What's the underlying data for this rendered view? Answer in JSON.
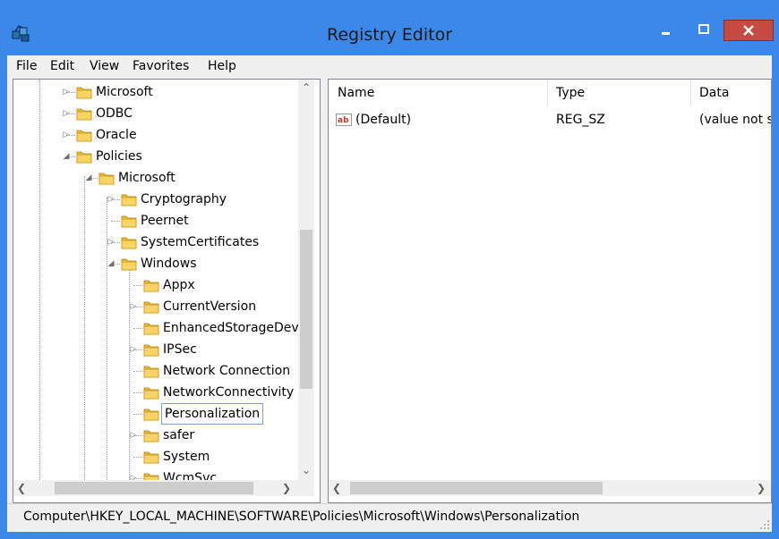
{
  "window": {
    "title": "Registry Editor",
    "accent_color": "#3c88e8",
    "close_color": "#c74a41"
  },
  "menu": [
    {
      "label": "File"
    },
    {
      "label": "Edit"
    },
    {
      "label": "View"
    },
    {
      "label": "Favorites"
    },
    {
      "label": "Help"
    }
  ],
  "tree": {
    "items": [
      {
        "label": "Microsoft",
        "depth": 1,
        "expander": "collapsed"
      },
      {
        "label": "ODBC",
        "depth": 1,
        "expander": "collapsed"
      },
      {
        "label": "Oracle",
        "depth": 1,
        "expander": "collapsed"
      },
      {
        "label": "Policies",
        "depth": 1,
        "expander": "expanded"
      },
      {
        "label": "Microsoft",
        "depth": 2,
        "expander": "expanded"
      },
      {
        "label": "Cryptography",
        "depth": 3,
        "expander": "collapsed"
      },
      {
        "label": "Peernet",
        "depth": 3,
        "expander": "none"
      },
      {
        "label": "SystemCertificates",
        "depth": 3,
        "expander": "collapsed"
      },
      {
        "label": "Windows",
        "depth": 3,
        "expander": "expanded"
      },
      {
        "label": "Appx",
        "depth": 4,
        "expander": "none"
      },
      {
        "label": "CurrentVersion",
        "depth": 4,
        "expander": "collapsed"
      },
      {
        "label": "EnhancedStorageDev",
        "depth": 4,
        "expander": "none"
      },
      {
        "label": "IPSec",
        "depth": 4,
        "expander": "collapsed"
      },
      {
        "label": "Network Connection",
        "depth": 4,
        "expander": "none"
      },
      {
        "label": "NetworkConnectivity",
        "depth": 4,
        "expander": "none"
      },
      {
        "label": "Personalization",
        "depth": 4,
        "expander": "none",
        "selected": true
      },
      {
        "label": "safer",
        "depth": 4,
        "expander": "collapsed"
      },
      {
        "label": "System",
        "depth": 4,
        "expander": "none"
      },
      {
        "label": "WcmSvc",
        "depth": 4,
        "expander": "collapsed"
      }
    ]
  },
  "list": {
    "columns": [
      {
        "label": "Name"
      },
      {
        "label": "Type"
      },
      {
        "label": "Data"
      }
    ],
    "rows": [
      {
        "name": "(Default)",
        "type": "REG_SZ",
        "data": "(value not s",
        "icon": "string-value-icon"
      }
    ]
  },
  "status": {
    "path": "Computer\\HKEY_LOCAL_MACHINE\\SOFTWARE\\Policies\\Microsoft\\Windows\\Personalization"
  }
}
